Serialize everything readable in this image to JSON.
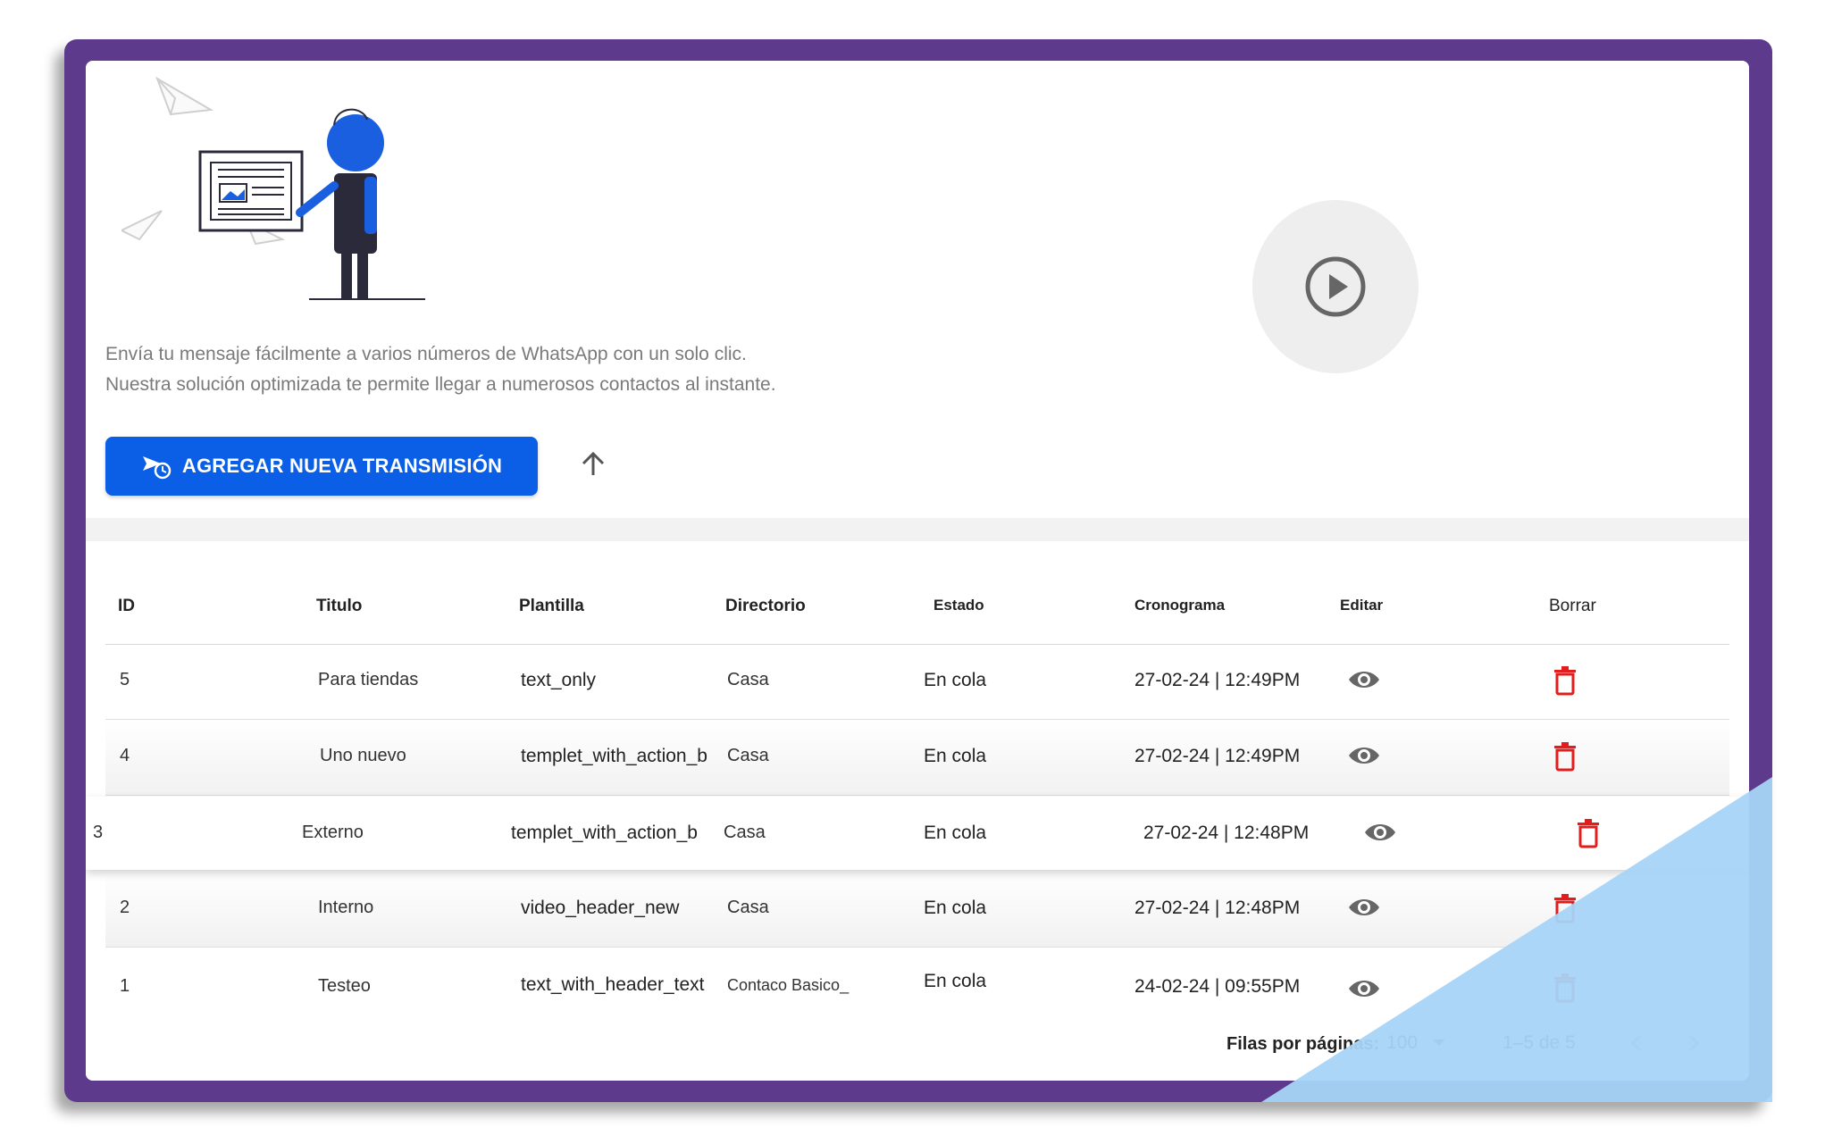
{
  "hero": {
    "description_line1": "Envía tu mensaje fácilmente a varios números de WhatsApp con un solo clic.",
    "description_line2": "Nuestra solución optimizada te permite llegar a numerosos contactos al instante.",
    "add_button_label": "AGREGAR NUEVA TRANSMISIÓN",
    "add_button_icon": "broadcast-clock-icon",
    "up_icon": "arrow-up-icon",
    "video_icon": "play-circle-icon"
  },
  "table": {
    "headers": {
      "id": "ID",
      "titulo": "Titulo",
      "plantilla": "Plantilla",
      "directorio": "Directorio",
      "estado": "Estado",
      "cronograma": "Cronograma",
      "editar": "Editar",
      "borrar": "Borrar"
    },
    "rows": [
      {
        "id": "5",
        "titulo": "Para tiendas",
        "plantilla": "text_only",
        "directorio": "Casa",
        "estado": "En cola",
        "cronograma": "27-02-24 | 12:49PM"
      },
      {
        "id": "4",
        "titulo": "Uno nuevo",
        "plantilla": "templet_with_action_b",
        "directorio": "Casa",
        "estado": "En cola",
        "cronograma": "27-02-24 | 12:49PM"
      },
      {
        "id": "3",
        "titulo": "Externo",
        "plantilla": "templet_with_action_b",
        "directorio": "Casa",
        "estado": "En cola",
        "cronograma": "27-02-24 | 12:48PM"
      },
      {
        "id": "2",
        "titulo": "Interno",
        "plantilla": "video_header_new",
        "directorio": "Casa",
        "estado": "En cola",
        "cronograma": "27-02-24 | 12:48PM"
      },
      {
        "id": "1",
        "titulo": "Testeo",
        "plantilla": "text_with_header_text",
        "directorio": "Contaco Basico_",
        "estado": "En cola",
        "cronograma": "24-02-24 | 09:55PM"
      }
    ],
    "edit_icon": "eye-icon",
    "delete_icon": "trash-icon"
  },
  "pagination": {
    "rows_per_page_label": "Filas por páginas:",
    "rows_per_page_value": "100",
    "range_label": "1–5 de 5"
  },
  "colors": {
    "frame": "#5e3a8c",
    "primary_button": "#0a5fe6",
    "delete_icon": "#e11d1d",
    "corner_accent": "#a6d4f7"
  }
}
